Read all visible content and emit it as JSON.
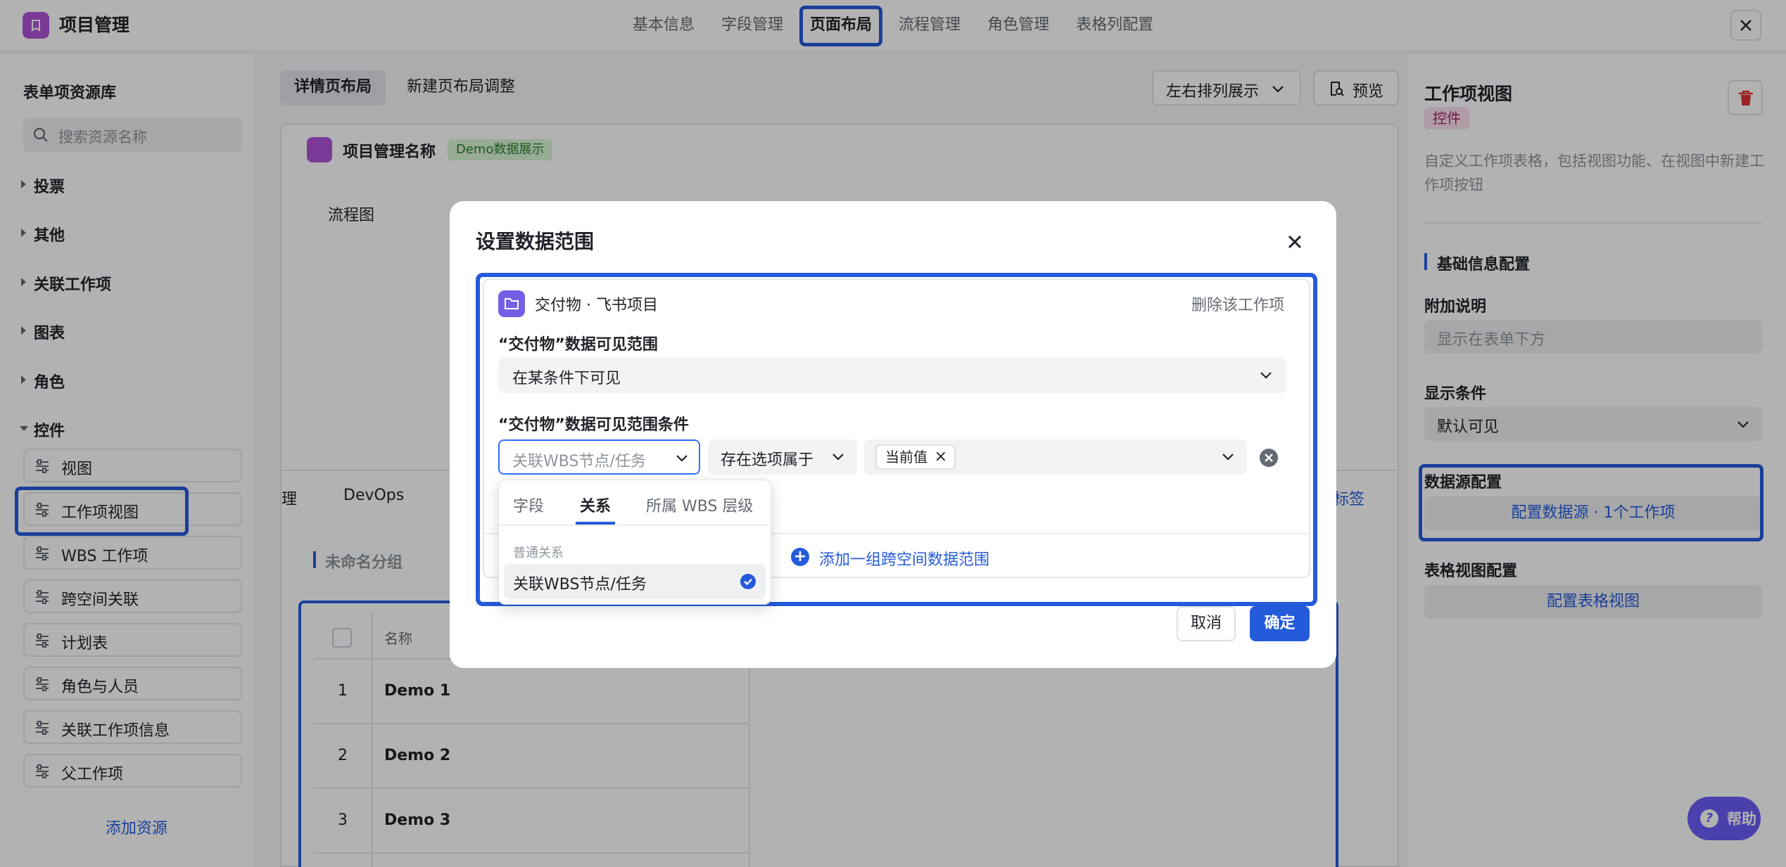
{
  "app": {
    "title": "项目管理"
  },
  "top_tabs": [
    "基本信息",
    "字段管理",
    "页面布局",
    "流程管理",
    "角色管理",
    "表格列配置"
  ],
  "left": {
    "title": "表单项资源库",
    "search_placeholder": "搜索资源名称",
    "categories": [
      "投票",
      "其他",
      "关联工作项",
      "图表",
      "角色",
      "控件"
    ],
    "controls": [
      "视图",
      "工作项视图",
      "WBS 工作项",
      "跨空间关联",
      "计划表",
      "角色与人员",
      "关联工作项信息",
      "父工作项"
    ],
    "add_resource": "添加资源"
  },
  "center": {
    "tabs": [
      "详情页布局",
      "新建页布局调整"
    ],
    "layout_select": "左右排列展示",
    "preview": "预览",
    "project_name": "项目管理名称",
    "demo_tag": "Demo数据展示",
    "flow_label": "流程图",
    "sub_tabs": [
      "理",
      "DevOps"
    ],
    "tag_link": "标签",
    "group_title": "未命名分组",
    "table": {
      "header_name": "名称",
      "rows": [
        {
          "num": "1",
          "name": "Demo 1"
        },
        {
          "num": "2",
          "name": "Demo 2"
        },
        {
          "num": "3",
          "name": "Demo 3"
        }
      ]
    }
  },
  "right": {
    "title": "工作项视图",
    "badge": "控件",
    "description": "自定义工作项表格，包括视图功能、在视图中新建工作项按钮",
    "section": "基础信息配置",
    "extra_label": "附加说明",
    "extra_placeholder": "显示在表单下方",
    "cond_label": "显示条件",
    "cond_value": "默认可见",
    "ds_label": "数据源配置",
    "ds_button": "配置数据源 · 1个工作项",
    "tv_label": "表格视图配置",
    "tv_button": "配置表格视图",
    "help": "帮助"
  },
  "modal": {
    "title": "设置数据范围",
    "card_name": "交付物 · 飞书项目",
    "card_delete": "删除该工作项",
    "scope_label": "“交付物”数据可见范围",
    "scope_value": "在某条件下可见",
    "cond_label": "“交付物”数据可见范围条件",
    "cond_field_placeholder": "关联WBS节点/任务",
    "cond_operator": "存在选项属于",
    "cond_value_chip": "当前值",
    "add_group": "添加一组跨空间数据范围",
    "cancel": "取消",
    "ok": "确定",
    "dropdown": {
      "tabs": [
        "字段",
        "关系",
        "所属 WBS 层级"
      ],
      "group": "普通关系",
      "option": "关联WBS节点/任务"
    }
  }
}
